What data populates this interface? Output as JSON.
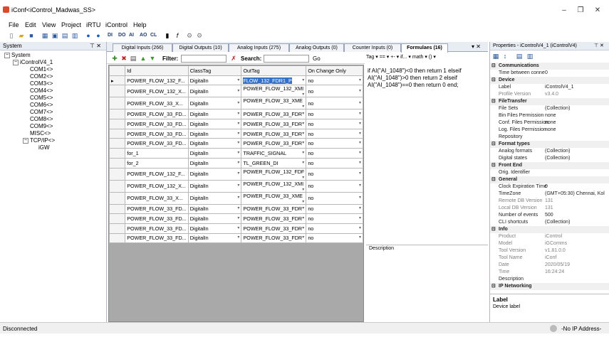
{
  "window": {
    "title": "iConf<iControl_Madwas_SS>",
    "min": "–",
    "max": "❐",
    "close": "✕"
  },
  "menu": [
    "File",
    "Edit",
    "View",
    "Project",
    "iRTU",
    "iControl",
    "Help"
  ],
  "toolbar": {
    "t1": "DI",
    "t2": "DO",
    "t3": "AI",
    "t4": "AO",
    "t5": "CL"
  },
  "system": {
    "title": "System",
    "pin": "⊤ ✕",
    "tree": [
      "System",
      "iControlV4_1",
      "COM1<>",
      "COM2<>",
      "COM3<>",
      "COM4<>",
      "COM5<>",
      "COM6<>",
      "COM7<>",
      "COM8<>",
      "COM9<>",
      "MISC<>",
      "TCP/IP<>",
      "iGW"
    ]
  },
  "tabs": [
    "Digital Inputs (266)",
    "Digital Outputs (10)",
    "Analog Inputs (275)",
    "Analog Outputs (0)",
    "Counter Inputs (0)",
    "Formulaes (16)"
  ],
  "tabctl": "▾ ✕",
  "gridtool": {
    "filter": "Filter:",
    "search": "Search:",
    "go": "Go"
  },
  "columns": [
    "Id",
    "ClassTag",
    "OutTag",
    "On Change Only"
  ],
  "rows": [
    [
      "POWER_FLOW_132_F...",
      "DigitalIn",
      "FLOW_132_FDR1_P",
      "no"
    ],
    [
      "POWER_FLOW_132_X...",
      "DigitalIn",
      "POWER_FLOW_132_XMI",
      "no"
    ],
    [
      "POWER_FLOW_33_X...",
      "DigitalIn",
      "POWER_FLOW_33_XME",
      "no"
    ],
    [
      "POWER_FLOW_33_FD...",
      "DigitalIn",
      "POWER_FLOW_33_FDR",
      "no"
    ],
    [
      "POWER_FLOW_33_FD...",
      "DigitalIn",
      "POWER_FLOW_33_FDR",
      "no"
    ],
    [
      "POWER_FLOW_33_FD...",
      "DigitalIn",
      "POWER_FLOW_33_FDR",
      "no"
    ],
    [
      "POWER_FLOW_33_FD...",
      "DigitalIn",
      "POWER_FLOW_33_FDR",
      "no"
    ],
    [
      "for_1",
      "DigitalIn",
      "TRAFFIC_SIGNAL",
      "no"
    ],
    [
      "for_2",
      "DigitalIn",
      "TL_GREEN_DI",
      "no"
    ],
    [
      "POWER_FLOW_132_F...",
      "DigitalIn",
      "POWER_FLOW_132_FDF",
      "no"
    ],
    [
      "POWER_FLOW_132_X...",
      "DigitalIn",
      "POWER_FLOW_132_XMI",
      "no"
    ],
    [
      "POWER_FLOW_33_X...",
      "DigitalIn",
      "POWER_FLOW_33_XME",
      "no"
    ],
    [
      "POWER_FLOW_33_FD...",
      "DigitalIn",
      "POWER_FLOW_33_FDR",
      "no"
    ],
    [
      "POWER_FLOW_33_FD...",
      "DigitalIn",
      "POWER_FLOW_33_FDR",
      "no"
    ],
    [
      "POWER_FLOW_33_FD...",
      "DigitalIn",
      "POWER_FLOW_33_FDR",
      "no"
    ],
    [
      "POWER_FLOW_33_FD...",
      "DigitalIn",
      "POWER_FLOW_33_FDR",
      "no"
    ]
  ],
  "formula": {
    "toolbar": "Tag ▾  ==  ▾  +-  ▾  if...  ▾  math  ▾  ()  ▾",
    "text": "if AI(\"AI_1048\")<0 then return 1 elseif AI(\"AI_1048\")>0 then return 2 elseif AI(\"AI_1048\")==0 then return 0 end;",
    "desc": "Description"
  },
  "props": {
    "title": "Properties - iControlV4_1 (iControlV4)",
    "pin": "⊤ ✕",
    "rows": [
      {
        "cat": true,
        "k": "Communications"
      },
      {
        "k": "Time between conne",
        "v": "0"
      },
      {
        "cat": true,
        "k": "Device"
      },
      {
        "k": "Label",
        "v": "iControlV4_1"
      },
      {
        "k": "Profile Version",
        "v": "v3.4.0",
        "dim": true
      },
      {
        "cat": true,
        "k": "FileTransfer"
      },
      {
        "k": "File Sets",
        "v": "(Collection)"
      },
      {
        "k": "Bin Files Permission",
        "v": "none"
      },
      {
        "k": "Conf. Files Permission",
        "v": "none"
      },
      {
        "k": "Log. Files Permission",
        "v": "none"
      },
      {
        "k": "Repository",
        "v": ""
      },
      {
        "cat": true,
        "k": "Format types"
      },
      {
        "k": "Analog formats",
        "v": "(Collection)"
      },
      {
        "k": "Digital states",
        "v": "(Collection)"
      },
      {
        "cat": true,
        "k": "Front End"
      },
      {
        "k": "Orig. Identifier",
        "v": ""
      },
      {
        "cat": true,
        "k": "General"
      },
      {
        "k": "Clock Expiration Time",
        "v": "0"
      },
      {
        "k": "TimeZone",
        "v": "(GMT+05:30) Chennai, Kol"
      },
      {
        "k": "Remote DB Version",
        "v": "131",
        "dim": true
      },
      {
        "k": "Local DB Version",
        "v": "131",
        "dim": true
      },
      {
        "k": "Number of events",
        "v": "500"
      },
      {
        "k": "CLI shortcuts",
        "v": "(Collection)"
      },
      {
        "cat": true,
        "k": "Info"
      },
      {
        "k": "Product",
        "v": "iControl",
        "dim": true
      },
      {
        "k": "Model",
        "v": "iGComms",
        "dim": true
      },
      {
        "k": "Tool Version",
        "v": "v1.81.0.0",
        "dim": true
      },
      {
        "k": "Tool Name",
        "v": "iConf",
        "dim": true
      },
      {
        "k": "Date",
        "v": "2020/05/19",
        "dim": true
      },
      {
        "k": "Time",
        "v": "16:24:24",
        "dim": true
      },
      {
        "k": "Description",
        "v": ""
      },
      {
        "cat": true,
        "k": "IP Networking"
      }
    ],
    "help_title": "Label",
    "help_text": "Device label"
  },
  "status": {
    "left": "Disconnected",
    "right": "-No IP Address-"
  }
}
